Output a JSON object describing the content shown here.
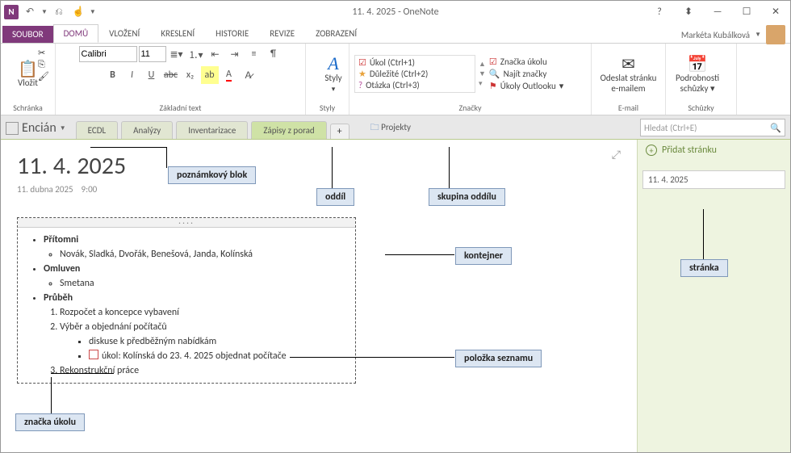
{
  "titlebar": {
    "title": "11. 4. 2025 - OneNote"
  },
  "tabs": {
    "file": "SOUBOR",
    "home": "DOMŮ",
    "insert": "VLOŽENÍ",
    "draw": "KRESLENÍ",
    "history": "HISTORIE",
    "review": "REVIZE",
    "view": "ZOBRAZENÍ"
  },
  "user": {
    "name": "Markéta Kubálková"
  },
  "ribbon": {
    "clipboard": {
      "paste": "Vložit",
      "label": "Schránka"
    },
    "font": {
      "family": "Calibri",
      "size": "11",
      "label": "Základní text"
    },
    "styles": {
      "btn": "Styly",
      "label": "Styly"
    },
    "tags": {
      "t1": "Úkol (Ctrl+1)",
      "t2": "Důležité (Ctrl+2)",
      "t3": "Otázka (Ctrl+3)",
      "s1": "Značka úkolu",
      "s2": "Najít značky",
      "s3": "Úkoly Outlooku",
      "label": "Značky"
    },
    "email": {
      "btn": "Odeslat stránku\ne-mailem",
      "label": "E-mail"
    },
    "meeting": {
      "btn": "Podrobnosti\nschůzky",
      "label": "Schůzky"
    }
  },
  "notebook": {
    "title": "Encián"
  },
  "sections": {
    "s1": "ECDL",
    "s2": "Analýzy",
    "s3": "Inventarizace",
    "s4": "Zápisy z porad",
    "plus": "+",
    "group": "Projekty"
  },
  "search": {
    "placeholder": "Hledat (Ctrl+E)"
  },
  "page": {
    "title": "11. 4. 2025",
    "date": "11. dubna 2025",
    "time": "9:00"
  },
  "content": {
    "h1": "Přítomni",
    "h1_li": "Novák, Sladká, Dvořák, Benešová, Janda, Kolínská",
    "h2": "Omluven",
    "h2_li": "Smetana",
    "h3": "Průběh",
    "o1": "Rozpočet a koncepce vybavení",
    "o2": "Výběr a objednání počítačů",
    "o2a": "diskuse k předběžným nabídkám",
    "o2b": "úkol: Kolínská do 23. 4. 2025 objednat počítače",
    "o3": "Rekonstrukční práce"
  },
  "sidepanel": {
    "add": "Přidat stránku",
    "p1": "11. 4. 2025"
  },
  "callouts": {
    "c1": "poznámkový blok",
    "c2": "oddíl",
    "c3": "skupina oddílu",
    "c4": "kontejner",
    "c5": "položka seznamu",
    "c6": "značka úkolu",
    "c7": "stránka"
  }
}
